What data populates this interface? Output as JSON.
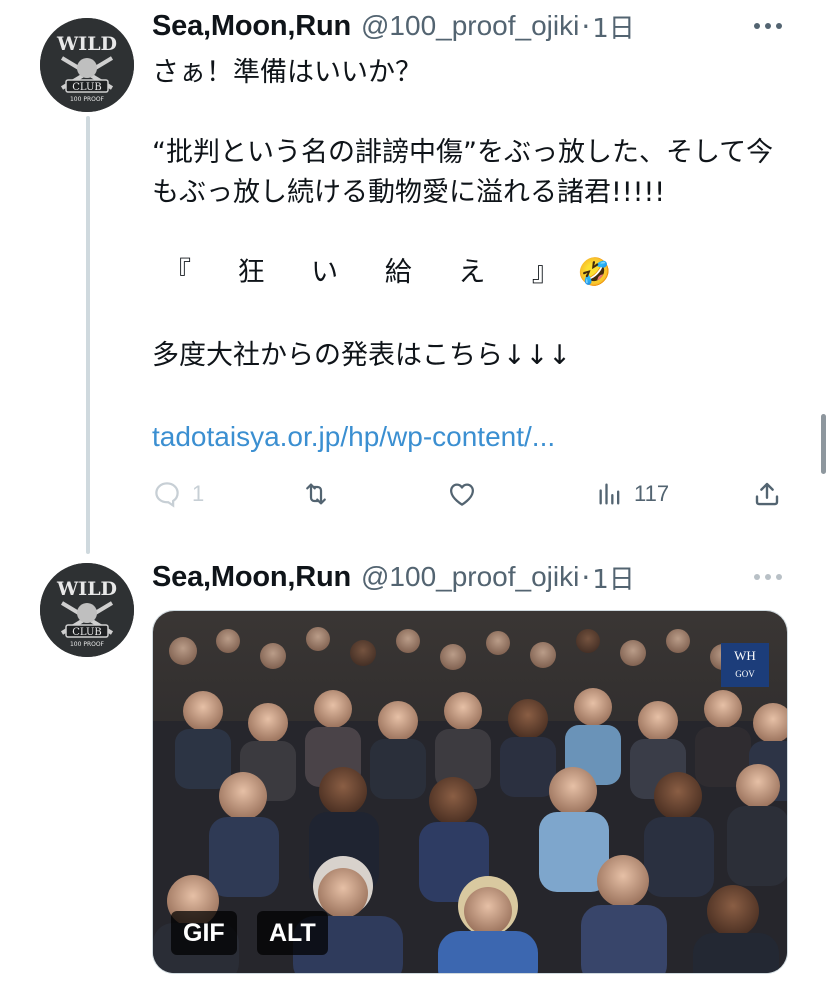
{
  "tweets": [
    {
      "display_name": "Sea,Moon,Run",
      "handle": "@100_proof_ojiki",
      "separator": "·",
      "time": "1日",
      "avatar_text": [
        "WILD",
        "CLUB",
        "100 PROOF"
      ],
      "text": {
        "line1": "さぁ！準備はいいか？",
        "para2": "“批判という名の誹謗中傷”をぶっ放した、そして今もぶっ放し続ける動物愛に溢れる諸君!!!!!",
        "line3": "『 狂 い 給 え 』🤣",
        "line4": "多度大社からの発表はこちら↓↓↓"
      },
      "link": "tadotaisya.or.jp/hp/wp-content/...",
      "actions": {
        "reply_count": "1",
        "retweet_count": "",
        "like_count": "",
        "views_count": "117"
      }
    },
    {
      "display_name": "Sea,Moon,Run",
      "handle": "@100_proof_ojiki",
      "separator": "·",
      "time": "1日",
      "avatar_text": [
        "WILD",
        "CLUB",
        "100 PROOF"
      ],
      "media": {
        "badge_gif": "GIF",
        "badge_alt": "ALT",
        "logo_text": [
          "WH",
          "GOV"
        ]
      }
    }
  ],
  "colors": {
    "text": "#0f1419",
    "secondary": "#536471",
    "link": "#3b8fd1",
    "thread_line": "#cfd9de"
  },
  "icons": [
    "more-icon",
    "reply-icon",
    "retweet-icon",
    "like-icon",
    "views-icon",
    "share-icon"
  ]
}
